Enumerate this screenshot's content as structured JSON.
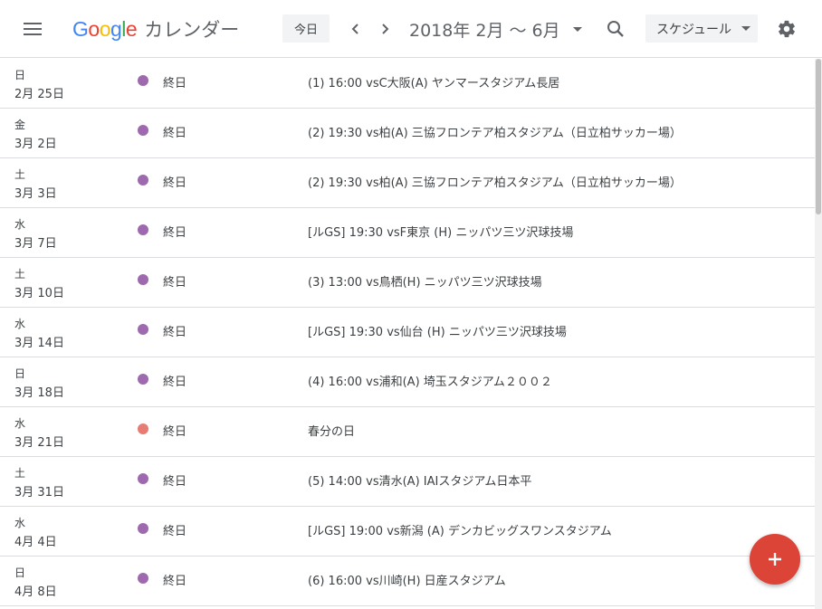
{
  "header": {
    "logo_letters": [
      "G",
      "o",
      "o",
      "g",
      "l",
      "e"
    ],
    "logo_colors": [
      "#4285F4",
      "#EA4335",
      "#FBBC05",
      "#4285F4",
      "#34A853",
      "#EA4335"
    ],
    "product_name": "カレンダー",
    "today_label": "今日",
    "date_range": "2018年 2月 〜 6月",
    "view_label": "スケジュール"
  },
  "colors": {
    "purple": "#9e69af",
    "red": "#e67c73",
    "fab": "#db4437"
  },
  "events": [
    {
      "dow": "日",
      "date": "2月 25日",
      "color": "#9e69af",
      "allday": "終日",
      "title": "(1) 16:00 vsC大阪(A)  ヤンマースタジアム長居"
    },
    {
      "dow": "金",
      "date": "3月 2日",
      "color": "#9e69af",
      "allday": "終日",
      "title": "(2) 19:30 vs柏(A)  三協フロンテア柏スタジアム（日立柏サッカー場）"
    },
    {
      "dow": "土",
      "date": "3月 3日",
      "color": "#9e69af",
      "allday": "終日",
      "title": "(2) 19:30 vs柏(A)  三協フロンテア柏スタジアム（日立柏サッカー場）"
    },
    {
      "dow": "水",
      "date": "3月 7日",
      "color": "#9e69af",
      "allday": "終日",
      "title": "[ルGS] 19:30 vsF東京 (H)  ニッパツ三ツ沢球技場"
    },
    {
      "dow": "土",
      "date": "3月 10日",
      "color": "#9e69af",
      "allday": "終日",
      "title": "(3) 13:00 vs鳥栖(H)  ニッパツ三ツ沢球技場"
    },
    {
      "dow": "水",
      "date": "3月 14日",
      "color": "#9e69af",
      "allday": "終日",
      "title": "[ルGS] 19:30 vs仙台 (H)  ニッパツ三ツ沢球技場"
    },
    {
      "dow": "日",
      "date": "3月 18日",
      "color": "#9e69af",
      "allday": "終日",
      "title": "(4) 16:00 vs浦和(A)  埼玉スタジアム２００２"
    },
    {
      "dow": "水",
      "date": "3月 21日",
      "color": "#e67c73",
      "allday": "終日",
      "title": "春分の日"
    },
    {
      "dow": "土",
      "date": "3月 31日",
      "color": "#9e69af",
      "allday": "終日",
      "title": "(5) 14:00 vs清水(A)  IAIスタジアム日本平"
    },
    {
      "dow": "水",
      "date": "4月 4日",
      "color": "#9e69af",
      "allday": "終日",
      "title": "[ルGS] 19:00 vs新潟 (A)  デンカビッグスワンスタジアム"
    },
    {
      "dow": "日",
      "date": "4月 8日",
      "color": "#9e69af",
      "allday": "終日",
      "title": "(6) 16:00 vs川崎(H)  日産スタジアム"
    }
  ],
  "fab": {
    "icon": "plus-icon"
  }
}
